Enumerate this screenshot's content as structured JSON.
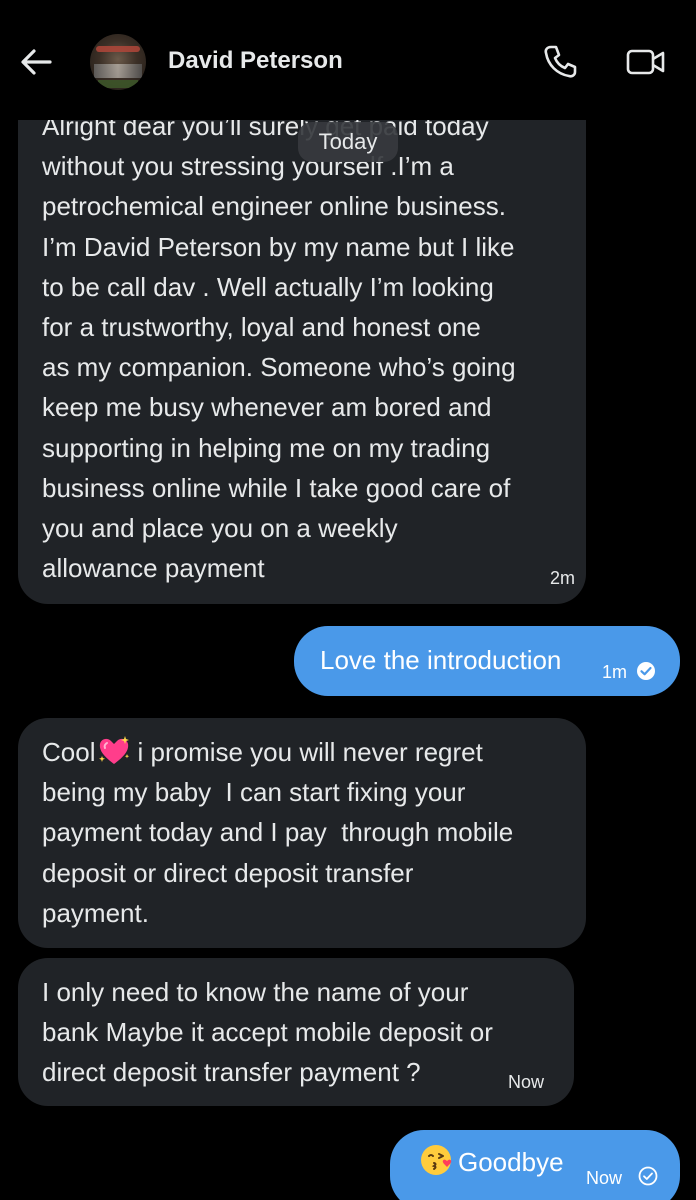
{
  "header": {
    "contact_name": "David Peterson",
    "back_icon": "arrow-left-icon",
    "call_icon": "phone-icon",
    "video_icon": "video-camera-icon"
  },
  "date_divider": "Today",
  "messages": [
    {
      "direction": "incoming",
      "text": "Alright dear you’ll surely get paid today\nwithout you stressing yourself .I’m a\npetrochemical engineer online business.\nI’m David Peterson by my name but I like\nto be call dav . Well actually I’m looking\nfor a trustworthy, loyal and honest one\nas my companion. Someone who’s going\nkeep me busy whenever am bored and\nsupporting in helping me on my trading\nbusiness online while I take good care of\nyou and place you on a weekly\nallowance payment",
      "time": "2m"
    },
    {
      "direction": "outgoing",
      "text": "Love the introduction",
      "time": "1m",
      "status_icon": "read-check-icon"
    },
    {
      "direction": "incoming",
      "text_before_emoji": "Cool",
      "emoji": "sparkling-heart-emoji",
      "text_after_emoji": "i promise you will never regret\nbeing my baby  I can start fixing your\npayment today and I pay  through mobile\ndeposit or direct deposit transfer\npayment."
    },
    {
      "direction": "incoming",
      "text": "I only need to know the name of your\nbank Maybe it accept mobile deposit or\ndirect deposit transfer payment ?",
      "time": "Now"
    },
    {
      "direction": "outgoing",
      "emoji": "face-blowing-kiss-emoji",
      "text": "Goodbye",
      "time": "Now",
      "status_icon": "read-check-icon"
    }
  ],
  "colors": {
    "background": "#000000",
    "incoming_bubble": "#202327",
    "outgoing_bubble": "#4a99e9",
    "text_primary": "#e7e9ea"
  }
}
